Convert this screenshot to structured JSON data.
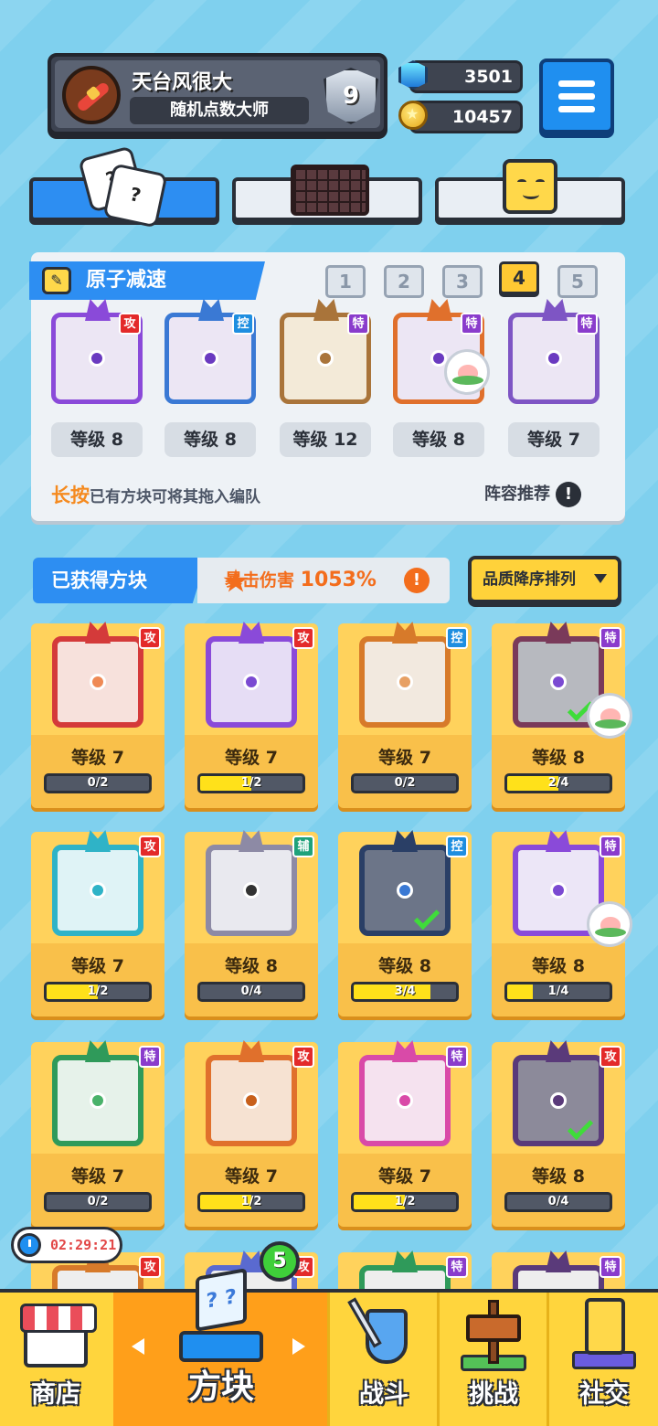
{
  "header": {
    "player_name": "天台风很大",
    "player_title": "随机点数大师",
    "rank": "9",
    "gems": "3501",
    "coins": "10457",
    "avatar_icon": "firecracker-icon",
    "gem_icon": "gem-icon",
    "coin_icon": "coin-icon",
    "menu_icon": "hamburger-menu-icon"
  },
  "tabs": [
    {
      "icon": "dice-icon",
      "active": true,
      "text": "?"
    },
    {
      "icon": "board-icon",
      "active": false
    },
    {
      "icon": "smiley-icon",
      "active": false
    }
  ],
  "deck": {
    "title": "原子减速",
    "slots": [
      "1",
      "2",
      "3",
      "4",
      "5"
    ],
    "active_slot": 4,
    "blocks": [
      {
        "tag": "攻",
        "tag_type": "atk",
        "level": "等级 8",
        "color": "#8a4ad9"
      },
      {
        "tag": "控",
        "tag_type": "ctl",
        "level": "等级 8",
        "color": "#3a79d4"
      },
      {
        "tag": "特",
        "tag_type": "spc",
        "level": "等级 12",
        "color": "#a9743a"
      },
      {
        "tag": "特",
        "tag_type": "spc",
        "level": "等级 8",
        "color": "#e0702c"
      },
      {
        "tag": "特",
        "tag_type": "spc",
        "level": "等级 7",
        "color": "#7e55c4"
      }
    ],
    "hint_highlight": "长按",
    "hint_text": "已有方块可将其拖入编队",
    "recommend": "阵容推荐",
    "recommend_icon": "!",
    "pencil_icon": "✎"
  },
  "owned": {
    "title": "已获得方块",
    "crit_label": "暴击伤害",
    "crit_value": "1053%",
    "crit_icon": "!",
    "sort_label": "品质降序排列"
  },
  "cards": [
    {
      "tag": "攻",
      "tag_type": "atk",
      "level": "等级 7",
      "progress": "0/2",
      "fill": 0,
      "color": "#d43a3a",
      "inner": "#f7e1dc",
      "dot": "#ef8a55"
    },
    {
      "tag": "攻",
      "tag_type": "atk",
      "level": "等级 7",
      "progress": "1/2",
      "fill": 0.5,
      "color": "#8a4ad9",
      "inner": "#e6ddf5",
      "dot": "#7b4ad2"
    },
    {
      "tag": "控",
      "tag_type": "ctl",
      "level": "等级 7",
      "progress": "0/2",
      "fill": 0,
      "color": "#d77a2a",
      "inner": "#f2e9df",
      "dot": "#e7a064"
    },
    {
      "tag": "特",
      "tag_type": "spc",
      "level": "等级 8",
      "progress": "2/4",
      "fill": 0.5,
      "color": "#7a3a5a",
      "inner": "#b7b9bf",
      "dot": "#7b4ad2",
      "check": true,
      "peach": true
    },
    {
      "tag": "攻",
      "tag_type": "atk",
      "level": "等级 7",
      "progress": "1/2",
      "fill": 0.5,
      "color": "#2fb3c7",
      "inner": "#dff3f6",
      "dot": "#2fb3c7"
    },
    {
      "tag": "辅",
      "tag_type": "sup",
      "level": "等级 8",
      "progress": "0/4",
      "fill": 0,
      "color": "#8d8aa5",
      "inner": "#e9e9ef",
      "dot": "#333333"
    },
    {
      "tag": "控",
      "tag_type": "ctl",
      "level": "等级 8",
      "progress": "3/4",
      "fill": 0.75,
      "color": "#2a3f66",
      "inner": "#6c7588",
      "dot": "#3a79d4",
      "check": true
    },
    {
      "tag": "特",
      "tag_type": "spc",
      "level": "等级 8",
      "progress": "1/4",
      "fill": 0.25,
      "color": "#8a4ad9",
      "inner": "#ece6f7",
      "dot": "#7b4ad2",
      "peach": true
    },
    {
      "tag": "特",
      "tag_type": "spc",
      "level": "等级 7",
      "progress": "0/2",
      "fill": 0,
      "color": "#2f9a5a",
      "inner": "#e6f2ea",
      "dot": "#49b26a"
    },
    {
      "tag": "攻",
      "tag_type": "atk",
      "level": "等级 7",
      "progress": "1/2",
      "fill": 0.5,
      "color": "#e0702c",
      "inner": "#f6e2d2",
      "dot": "#c8601c"
    },
    {
      "tag": "特",
      "tag_type": "spc",
      "level": "等级 7",
      "progress": "1/2",
      "fill": 0.5,
      "color": "#d94aa8",
      "inner": "#f5e2ef",
      "dot": "#d94aa8"
    },
    {
      "tag": "攻",
      "tag_type": "atk",
      "level": "等级 8",
      "progress": "0/4",
      "fill": 0,
      "color": "#5a3a7a",
      "inner": "#8c8a9a",
      "dot": "#5a3a7a",
      "check": true
    },
    {
      "tag": "攻",
      "tag_type": "atk",
      "color": "#d77a2a",
      "partial": true
    },
    {
      "tag": "攻",
      "tag_type": "atk",
      "color": "#5a6ad0",
      "partial": true
    },
    {
      "tag": "特",
      "tag_type": "spc",
      "color": "#2f9a5a",
      "partial": true
    },
    {
      "tag": "特",
      "tag_type": "spc",
      "color": "#5a3a7a",
      "partial": true
    }
  ],
  "shop_timer": "02:29:21",
  "blocks_badge": "5",
  "nav": [
    {
      "label": "商店",
      "icon": "shop-icon"
    },
    {
      "label": "方块",
      "icon": "cube-icon",
      "active": true,
      "icon_text": "? ?"
    },
    {
      "label": "战斗",
      "icon": "shield-sword-icon"
    },
    {
      "label": "挑战",
      "icon": "signpost-icon"
    },
    {
      "label": "社交",
      "icon": "character-icon"
    }
  ]
}
